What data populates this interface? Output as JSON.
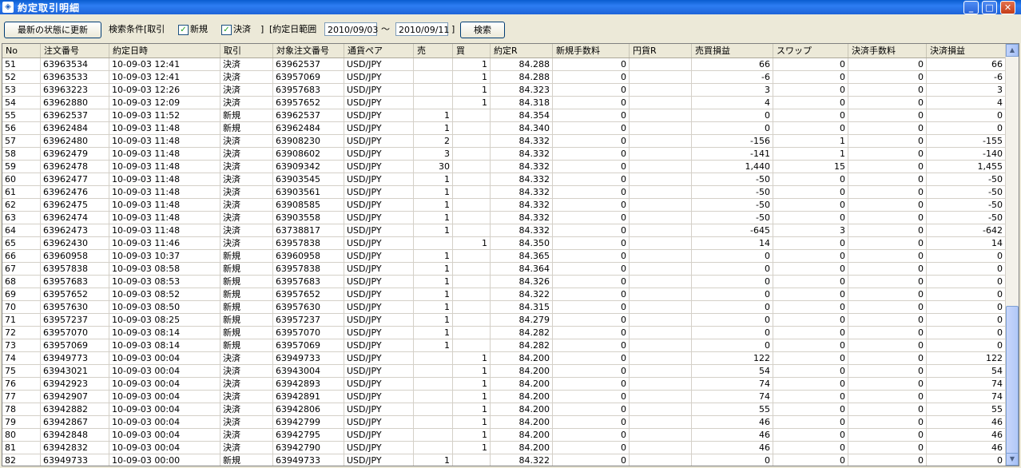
{
  "window": {
    "title": "約定取引明細",
    "icon": "app-icon"
  },
  "toolbar": {
    "refresh_label": "最新の状態に更新",
    "filter_label": "検索条件[取引",
    "chk_new_label": "新規",
    "chk_settle_label": "決済",
    "bracket_close": "]",
    "range_label": "[約定日範囲",
    "date_from": "2010/09/03",
    "tilde": "～",
    "date_to": "2010/09/11",
    "range_close": "]",
    "search_label": "検索",
    "chk_new_checked": true,
    "chk_settle_checked": true
  },
  "table": {
    "columns": [
      "No",
      "注文番号",
      "約定日時",
      "取引",
      "対象注文番号",
      "通貨ペア",
      "売",
      "買",
      "約定R",
      "新規手数料",
      "円貨R",
      "売買損益",
      "スワップ",
      "決済手数料",
      "決済損益"
    ],
    "rows": [
      [
        "51",
        "63963534",
        "10-09-03 12:41",
        "決済",
        "63962537",
        "USD/JPY",
        "",
        "1",
        "84.288",
        "0",
        "",
        "66",
        "0",
        "0",
        "66"
      ],
      [
        "52",
        "63963533",
        "10-09-03 12:41",
        "決済",
        "63957069",
        "USD/JPY",
        "",
        "1",
        "84.288",
        "0",
        "",
        "-6",
        "0",
        "0",
        "-6"
      ],
      [
        "53",
        "63963223",
        "10-09-03 12:26",
        "決済",
        "63957683",
        "USD/JPY",
        "",
        "1",
        "84.323",
        "0",
        "",
        "3",
        "0",
        "0",
        "3"
      ],
      [
        "54",
        "63962880",
        "10-09-03 12:09",
        "決済",
        "63957652",
        "USD/JPY",
        "",
        "1",
        "84.318",
        "0",
        "",
        "4",
        "0",
        "0",
        "4"
      ],
      [
        "55",
        "63962537",
        "10-09-03 11:52",
        "新規",
        "63962537",
        "USD/JPY",
        "1",
        "",
        "84.354",
        "0",
        "",
        "0",
        "0",
        "0",
        "0"
      ],
      [
        "56",
        "63962484",
        "10-09-03 11:48",
        "新規",
        "63962484",
        "USD/JPY",
        "1",
        "",
        "84.340",
        "0",
        "",
        "0",
        "0",
        "0",
        "0"
      ],
      [
        "57",
        "63962480",
        "10-09-03 11:48",
        "決済",
        "63908230",
        "USD/JPY",
        "2",
        "",
        "84.332",
        "0",
        "",
        "-156",
        "1",
        "0",
        "-155"
      ],
      [
        "58",
        "63962479",
        "10-09-03 11:48",
        "決済",
        "63908602",
        "USD/JPY",
        "3",
        "",
        "84.332",
        "0",
        "",
        "-141",
        "1",
        "0",
        "-140"
      ],
      [
        "59",
        "63962478",
        "10-09-03 11:48",
        "決済",
        "63909342",
        "USD/JPY",
        "30",
        "",
        "84.332",
        "0",
        "",
        "1,440",
        "15",
        "0",
        "1,455"
      ],
      [
        "60",
        "63962477",
        "10-09-03 11:48",
        "決済",
        "63903545",
        "USD/JPY",
        "1",
        "",
        "84.332",
        "0",
        "",
        "-50",
        "0",
        "0",
        "-50"
      ],
      [
        "61",
        "63962476",
        "10-09-03 11:48",
        "決済",
        "63903561",
        "USD/JPY",
        "1",
        "",
        "84.332",
        "0",
        "",
        "-50",
        "0",
        "0",
        "-50"
      ],
      [
        "62",
        "63962475",
        "10-09-03 11:48",
        "決済",
        "63908585",
        "USD/JPY",
        "1",
        "",
        "84.332",
        "0",
        "",
        "-50",
        "0",
        "0",
        "-50"
      ],
      [
        "63",
        "63962474",
        "10-09-03 11:48",
        "決済",
        "63903558",
        "USD/JPY",
        "1",
        "",
        "84.332",
        "0",
        "",
        "-50",
        "0",
        "0",
        "-50"
      ],
      [
        "64",
        "63962473",
        "10-09-03 11:48",
        "決済",
        "63738817",
        "USD/JPY",
        "1",
        "",
        "84.332",
        "0",
        "",
        "-645",
        "3",
        "0",
        "-642"
      ],
      [
        "65",
        "63962430",
        "10-09-03 11:46",
        "決済",
        "63957838",
        "USD/JPY",
        "",
        "1",
        "84.350",
        "0",
        "",
        "14",
        "0",
        "0",
        "14"
      ],
      [
        "66",
        "63960958",
        "10-09-03 10:37",
        "新規",
        "63960958",
        "USD/JPY",
        "1",
        "",
        "84.365",
        "0",
        "",
        "0",
        "0",
        "0",
        "0"
      ],
      [
        "67",
        "63957838",
        "10-09-03 08:58",
        "新規",
        "63957838",
        "USD/JPY",
        "1",
        "",
        "84.364",
        "0",
        "",
        "0",
        "0",
        "0",
        "0"
      ],
      [
        "68",
        "63957683",
        "10-09-03 08:53",
        "新規",
        "63957683",
        "USD/JPY",
        "1",
        "",
        "84.326",
        "0",
        "",
        "0",
        "0",
        "0",
        "0"
      ],
      [
        "69",
        "63957652",
        "10-09-03 08:52",
        "新規",
        "63957652",
        "USD/JPY",
        "1",
        "",
        "84.322",
        "0",
        "",
        "0",
        "0",
        "0",
        "0"
      ],
      [
        "70",
        "63957630",
        "10-09-03 08:50",
        "新規",
        "63957630",
        "USD/JPY",
        "1",
        "",
        "84.315",
        "0",
        "",
        "0",
        "0",
        "0",
        "0"
      ],
      [
        "71",
        "63957237",
        "10-09-03 08:25",
        "新規",
        "63957237",
        "USD/JPY",
        "1",
        "",
        "84.279",
        "0",
        "",
        "0",
        "0",
        "0",
        "0"
      ],
      [
        "72",
        "63957070",
        "10-09-03 08:14",
        "新規",
        "63957070",
        "USD/JPY",
        "1",
        "",
        "84.282",
        "0",
        "",
        "0",
        "0",
        "0",
        "0"
      ],
      [
        "73",
        "63957069",
        "10-09-03 08:14",
        "新規",
        "63957069",
        "USD/JPY",
        "1",
        "",
        "84.282",
        "0",
        "",
        "0",
        "0",
        "0",
        "0"
      ],
      [
        "74",
        "63949773",
        "10-09-03 00:04",
        "決済",
        "63949733",
        "USD/JPY",
        "",
        "1",
        "84.200",
        "0",
        "",
        "122",
        "0",
        "0",
        "122"
      ],
      [
        "75",
        "63943021",
        "10-09-03 00:04",
        "決済",
        "63943004",
        "USD/JPY",
        "",
        "1",
        "84.200",
        "0",
        "",
        "54",
        "0",
        "0",
        "54"
      ],
      [
        "76",
        "63942923",
        "10-09-03 00:04",
        "決済",
        "63942893",
        "USD/JPY",
        "",
        "1",
        "84.200",
        "0",
        "",
        "74",
        "0",
        "0",
        "74"
      ],
      [
        "77",
        "63942907",
        "10-09-03 00:04",
        "決済",
        "63942891",
        "USD/JPY",
        "",
        "1",
        "84.200",
        "0",
        "",
        "74",
        "0",
        "0",
        "74"
      ],
      [
        "78",
        "63942882",
        "10-09-03 00:04",
        "決済",
        "63942806",
        "USD/JPY",
        "",
        "1",
        "84.200",
        "0",
        "",
        "55",
        "0",
        "0",
        "55"
      ],
      [
        "79",
        "63942867",
        "10-09-03 00:04",
        "決済",
        "63942799",
        "USD/JPY",
        "",
        "1",
        "84.200",
        "0",
        "",
        "46",
        "0",
        "0",
        "46"
      ],
      [
        "80",
        "63942848",
        "10-09-03 00:04",
        "決済",
        "63942795",
        "USD/JPY",
        "",
        "1",
        "84.200",
        "0",
        "",
        "46",
        "0",
        "0",
        "46"
      ],
      [
        "81",
        "63942832",
        "10-09-03 00:04",
        "決済",
        "63942790",
        "USD/JPY",
        "",
        "1",
        "84.200",
        "0",
        "",
        "46",
        "0",
        "0",
        "46"
      ],
      [
        "82",
        "63949733",
        "10-09-03 00:00",
        "新規",
        "63949733",
        "USD/JPY",
        "1",
        "",
        "84.322",
        "0",
        "",
        "0",
        "0",
        "0",
        "0"
      ]
    ]
  },
  "colors": {
    "titlebar": "#2d7df2",
    "grid_line": "#d4d0c8",
    "face": "#ece9d8"
  },
  "icons": {
    "minimize": "minimize-icon",
    "maximize": "maximize-icon",
    "close": "close-icon",
    "scroll_up": "arrow-up-icon",
    "scroll_down": "arrow-down-icon"
  }
}
